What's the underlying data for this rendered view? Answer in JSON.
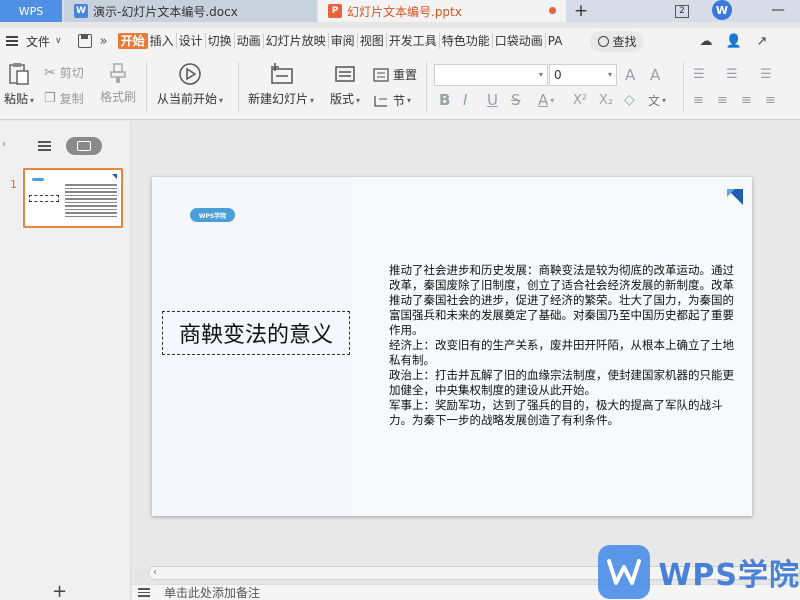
{
  "tabs": {
    "wps_label": "WPS",
    "doc_icon_letter": "W",
    "doc_tab": "演示-幻灯片文本编号.docx",
    "ppt_icon_letter": "P",
    "ppt_tab": "幻灯片文本编号.pptx",
    "new_tab": "+",
    "number_badge": "2",
    "avatar_letter": "W"
  },
  "menu": {
    "file": "文件",
    "items": [
      "开始",
      "插入",
      "设计",
      "切换",
      "动画",
      "幻灯片放映",
      "审阅",
      "视图",
      "开发工具",
      "特色功能",
      "口袋动画",
      "PA"
    ],
    "active_index": 0,
    "search": "查找"
  },
  "ribbon": {
    "paste": "粘贴",
    "cut": "剪切",
    "copy": "复制",
    "format_painter": "格式刷",
    "play_from_current": "从当前开始",
    "new_slide": "新建幻灯片",
    "layout": "版式",
    "reset": "重置",
    "section": "节",
    "font_size": "0"
  },
  "thumbnails": {
    "slide_number": "1"
  },
  "slide": {
    "badge": "WPS学院",
    "title": "商鞅变法的意义",
    "paragraphs": [
      "推动了社会进步和历史发展：商鞅变法是较为彻底的改革运动。通过改革，秦国废除了旧制度，创立了适合社会经济发展的新制度。改革推动了秦国社会的进步，促进了经济的繁荣。壮大了国力，为秦国的富国强兵和未来的发展奠定了基础。对秦国乃至中国历史都起了重要作用。",
      "经济上：改变旧有的生产关系，废井田开阡陌，从根本上确立了土地私有制。",
      "政治上：打击并瓦解了旧的血缘宗法制度，使封建国家机器的只能更加健全，中央集权制度的建设从此开始。",
      "军事上：奖励军功，达到了强兵的目的，极大的提高了军队的战斗力。为秦下一步的战略发展创造了有利条件。"
    ]
  },
  "notes": {
    "placeholder": "单击此处添加备注"
  },
  "watermark": {
    "text": "WPS学院"
  },
  "colors": {
    "accent": "#e97a3a",
    "wps_blue": "#4f8fe6",
    "badge_blue": "#4a9fd8",
    "corner_blue": "#1f5ea8"
  }
}
